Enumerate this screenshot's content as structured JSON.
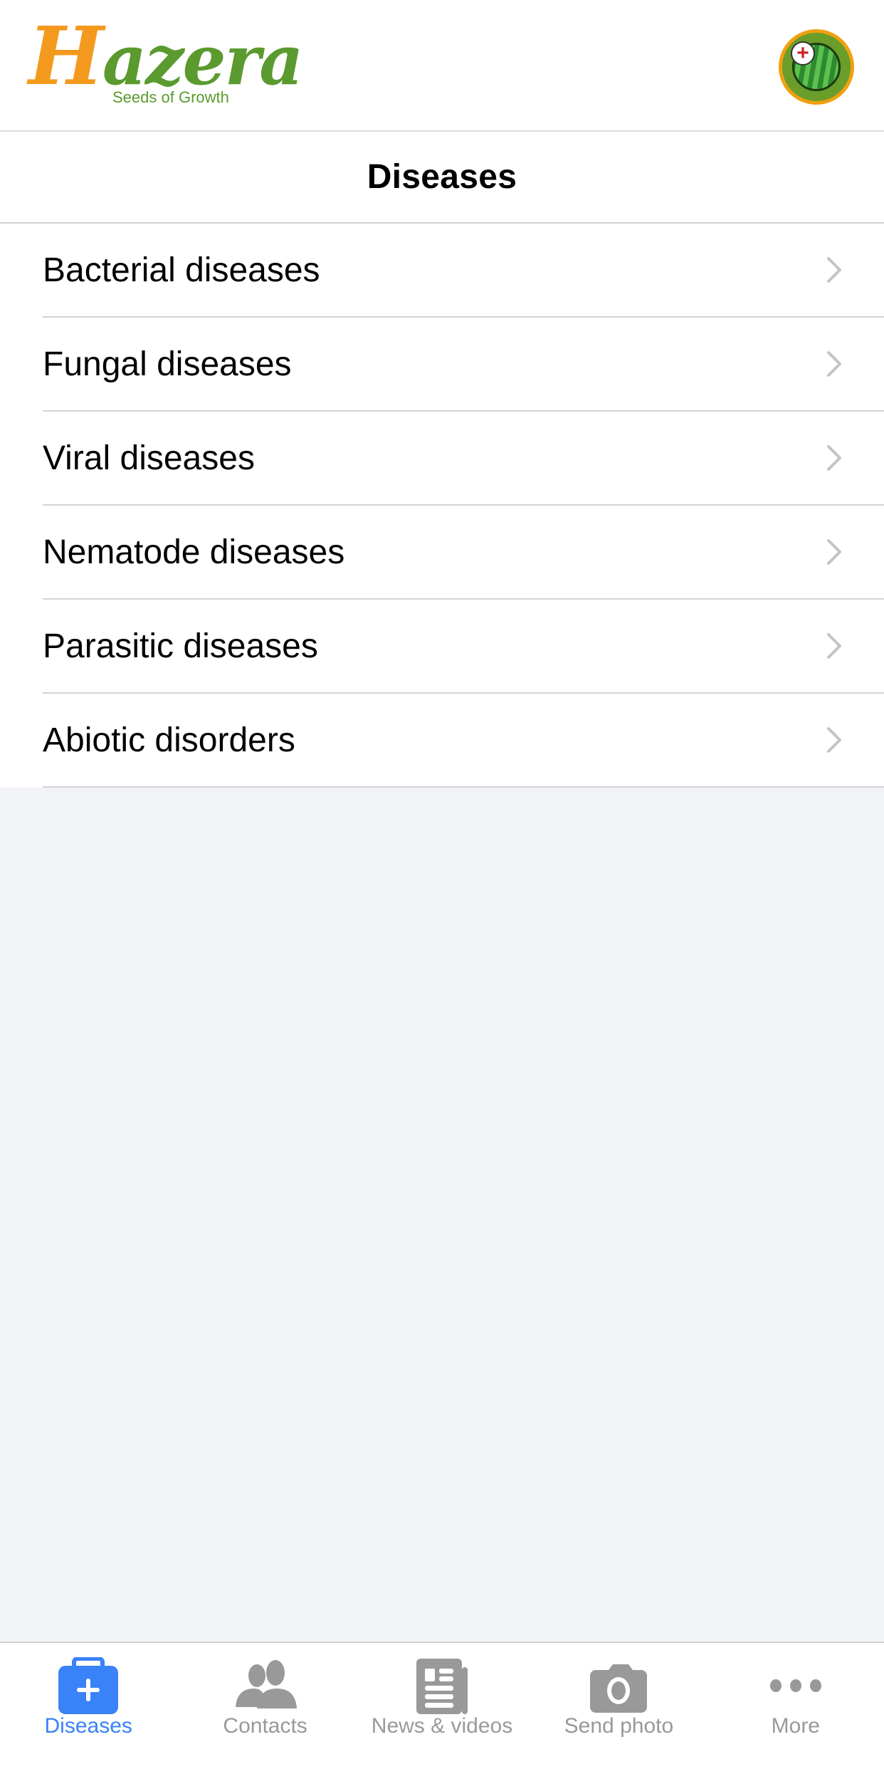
{
  "header": {
    "logo": {
      "word_first": "H",
      "word_rest": "azera",
      "tagline": "Seeds of Growth"
    },
    "avatar_icon": "watermelon-first-aid-icon",
    "avatar_badge": "+"
  },
  "page": {
    "title": "Diseases"
  },
  "list": {
    "items": [
      {
        "label": "Bacterial diseases",
        "icon": "chevron-right-icon"
      },
      {
        "label": "Fungal diseases",
        "icon": "chevron-right-icon"
      },
      {
        "label": "Viral diseases",
        "icon": "chevron-right-icon"
      },
      {
        "label": "Nematode diseases",
        "icon": "chevron-right-icon"
      },
      {
        "label": "Parasitic diseases",
        "icon": "chevron-right-icon"
      },
      {
        "label": "Abiotic disorders",
        "icon": "chevron-right-icon"
      }
    ]
  },
  "tabbar": {
    "active": "Diseases",
    "tabs": [
      {
        "label": "Diseases",
        "icon": "medical-kit-icon"
      },
      {
        "label": "Contacts",
        "icon": "people-icon"
      },
      {
        "label": "News & videos",
        "icon": "newspaper-icon"
      },
      {
        "label": "Send photo",
        "icon": "camera-icon"
      },
      {
        "label": "More",
        "icon": "more-dots-icon"
      }
    ]
  },
  "colors": {
    "brand_orange": "#f39a1e",
    "brand_green": "#5a9a2f",
    "active_tab": "#3a82f7",
    "inactive_tab": "#999999",
    "background": "#f2f3f7"
  }
}
